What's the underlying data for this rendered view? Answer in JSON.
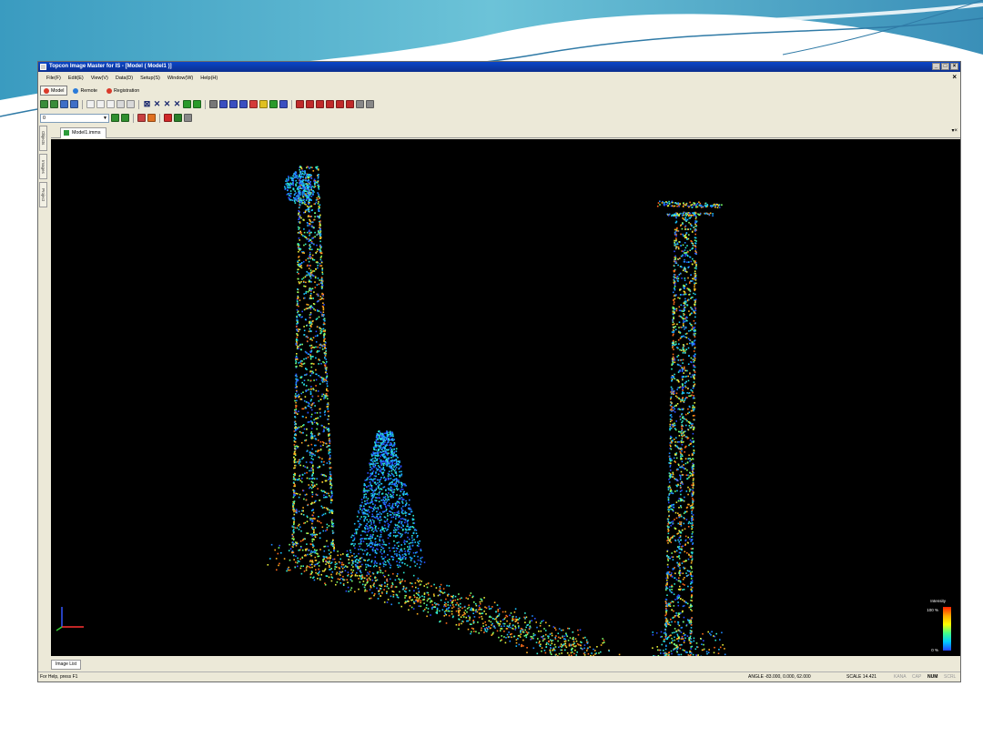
{
  "window": {
    "title": "Topcon Image Master for IS - [Model ( Model1 )]",
    "controls": [
      "_",
      "□",
      "×"
    ]
  },
  "menu": [
    "File(F)",
    "Edit(E)",
    "View(V)",
    "Data(D)",
    "Setup(S)",
    "Window(W)",
    "Help(H)"
  ],
  "modes": [
    {
      "label": "Model",
      "active": true,
      "color": "#d93a2a"
    },
    {
      "label": "Remote",
      "active": false,
      "color": "#2a7bd9"
    },
    {
      "label": "Registration",
      "active": false,
      "color": "#d93a2a"
    }
  ],
  "toolbar": {
    "layer_value": "0",
    "icon_colors_row1": [
      "#3a8d3a",
      "#3a8d3a",
      "#3f6fc7",
      "#3f6fc7",
      "#888888",
      "#888888",
      "#888888",
      "#888888"
    ],
    "icon_colors_row1b": [
      "#2a9a2a",
      "#2a9a2a",
      "#777777",
      "#3a4fc0",
      "#3a4fc0",
      "#3a4fc0",
      "#d43a3a",
      "#e0c020",
      "#2a9a2a",
      "#3a4fc0",
      "#c02a2a",
      "#c02a2a",
      "#c02a2a",
      "#c02a2a",
      "#c02a2a",
      "#888888",
      "#888888"
    ],
    "icon_colors_row2": [
      "#2f8f2f",
      "#2f8f2f",
      "#c84040",
      "#e07020",
      "#d02828",
      "#2a7f2a",
      "#888888"
    ]
  },
  "side_tabs": [
    "Objects",
    "Images",
    "Project"
  ],
  "document_tab": "Model1.imms",
  "bottom_tab": "Image List",
  "legend": {
    "title": "Intensity",
    "max_label": "100 %",
    "min_label": "0 %"
  },
  "status": {
    "help": "For Help, press F1",
    "angle": "ANGLE -83.000, 0.000, 62.000",
    "scale": "SCALE 14.421",
    "kana": "KANA",
    "cap": "CAP",
    "num": "NUM",
    "scrl": "SCRL"
  },
  "colors": {
    "viewport_bg": "#000000",
    "titlebar": "#0b3aa8",
    "window_bg": "#ece9d8"
  }
}
